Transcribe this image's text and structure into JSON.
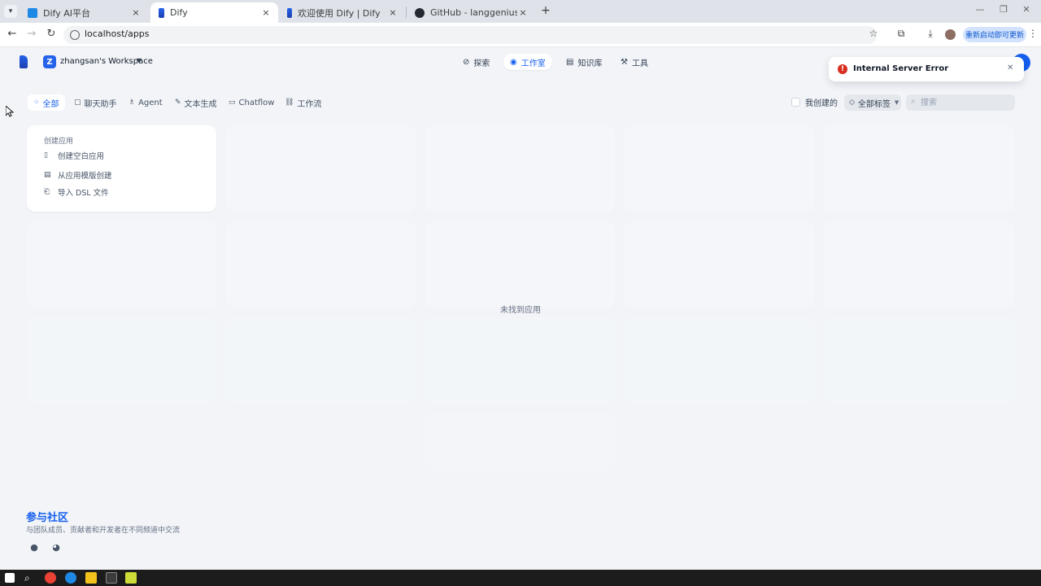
{
  "browser": {
    "tabs": [
      {
        "title": "Dify AI平台",
        "close": "×"
      },
      {
        "title": "Dify",
        "close": "×"
      },
      {
        "title": "欢迎使用 Dify | Dify",
        "close": "×"
      },
      {
        "title": "GitHub - langgenius/dify at",
        "close": "×"
      }
    ],
    "new_tab": "+",
    "url": "localhost/apps",
    "update_button": "重新启动即可更新"
  },
  "header": {
    "workspace_initial": "Z",
    "workspace_name": "zhangsan's Workspace",
    "nav": [
      {
        "label": "探索",
        "icon": "explore-icon"
      },
      {
        "label": "工作室",
        "icon": "studio-icon"
      },
      {
        "label": "知识库",
        "icon": "knowledge-icon"
      },
      {
        "label": "工具",
        "icon": "tools-icon"
      }
    ],
    "active_nav": "工作室"
  },
  "toast": {
    "message": "Internal Server Error",
    "status_color": "#d92d20"
  },
  "filters": {
    "tabs": [
      "全部",
      "聊天助手",
      "Agent",
      "文本生成",
      "Chatflow",
      "工作流"
    ],
    "active": "全部",
    "mine_label": "我创建的",
    "mine_checked": false,
    "tags_label": "全部标签",
    "search_placeholder": "搜索"
  },
  "create_card": {
    "title": "创建应用",
    "items": [
      "创建空白应用",
      "从应用模版创建",
      "导入 DSL 文件"
    ]
  },
  "empty_text": "未找到应用",
  "community": {
    "title": "参与社区",
    "subtitle": "与团队成员、贡献者和开发者在不同频道中交流"
  },
  "colors": {
    "accent": "#155eef",
    "background": "#f2f4f7"
  }
}
